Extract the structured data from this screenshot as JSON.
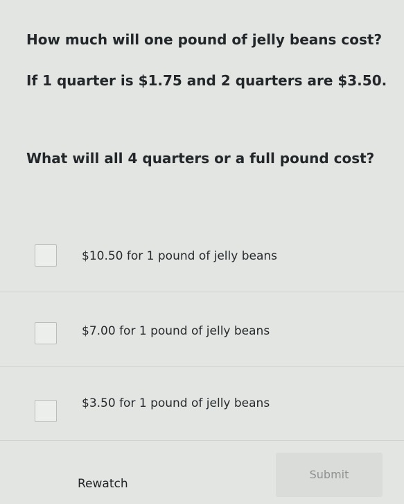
{
  "question": {
    "line1": "How much will one pound of jelly beans cost?",
    "line2": "If 1 quarter is $1.75 and 2 quarters are $3.50.",
    "line3": "What will all 4 quarters or a full pound cost?"
  },
  "choices": [
    {
      "label": "$10.50 for 1 pound of jelly beans",
      "checked": false
    },
    {
      "label": "$7.00 for 1 pound of jelly beans",
      "checked": false
    },
    {
      "label": "$3.50 for 1 pound of jelly beans",
      "checked": false
    }
  ],
  "actions": {
    "rewatch_label": "Rewatch",
    "submit_label": "Submit",
    "submit_enabled": false
  },
  "colors": {
    "background": "#e3e5e3",
    "text": "#23272a",
    "disabled_text": "#8d9190",
    "checkbox_border": "#b9bcbb"
  }
}
